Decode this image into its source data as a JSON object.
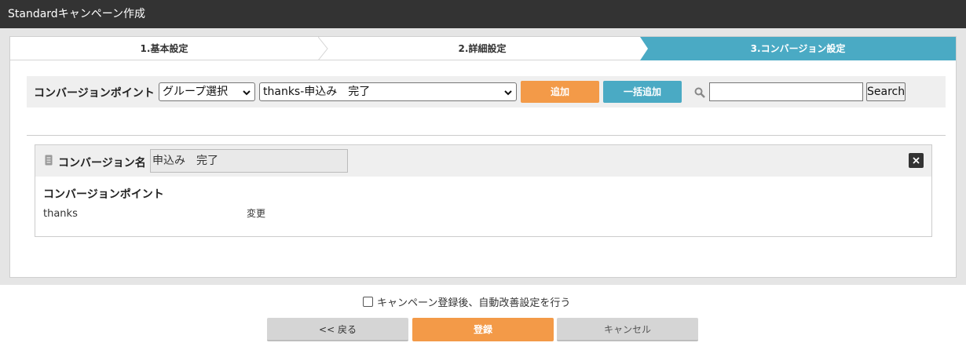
{
  "window": {
    "title": "Standardキャンペーン作成"
  },
  "steps": [
    {
      "label": "1.基本設定",
      "active": false
    },
    {
      "label": "2.詳細設定",
      "active": false
    },
    {
      "label": "3.コンバージョン設定",
      "active": true
    }
  ],
  "toolbar": {
    "label": "コンバージョンポイント",
    "group_select": {
      "value": "グループ選択"
    },
    "point_select": {
      "value": "thanks-申込み　完了"
    },
    "add_label": "追加",
    "bulk_add_label": "一括追加",
    "search_value": "",
    "search_label": "Search",
    "search_icon": "magnifier-icon"
  },
  "conversion": {
    "name_label": "コンバージョン名",
    "name_value": "申込み　完了",
    "point_heading": "コンバージョンポイント",
    "point_value": "thanks",
    "change_label": "変更"
  },
  "footer": {
    "auto_improve_label": "キャンペーン登録後、自動改善設定を行う",
    "auto_improve_checked": false,
    "back_label": "<< 戻る",
    "register_label": "登録",
    "cancel_label": "キャンセル"
  },
  "colors": {
    "titlebar": "#333333",
    "active_step": "#4aaac4",
    "accent_orange": "#f39a48",
    "accent_blue": "#4aaac4"
  }
}
